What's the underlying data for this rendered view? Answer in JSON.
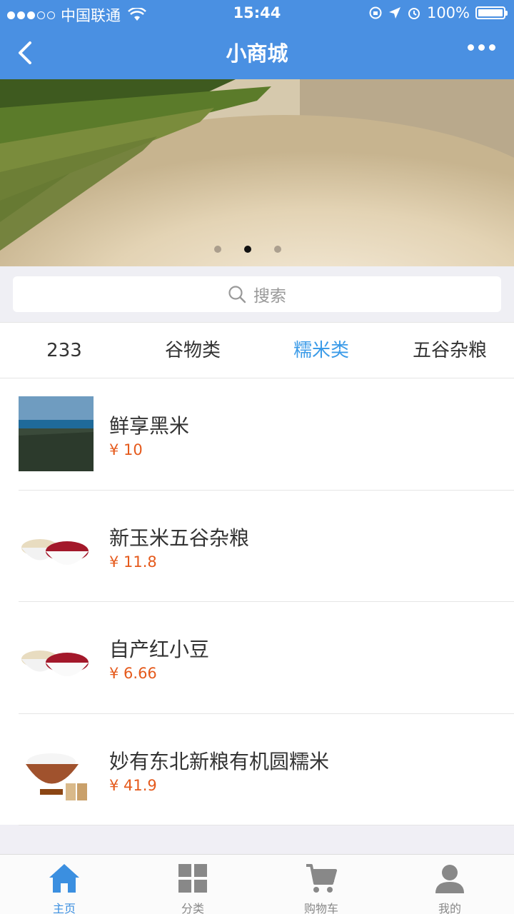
{
  "status_bar": {
    "carrier": "中国联通",
    "time": "15:44",
    "battery": "100%"
  },
  "nav": {
    "title": "小商城"
  },
  "search": {
    "placeholder": "搜索"
  },
  "tabs": [
    {
      "label": "233",
      "active": false
    },
    {
      "label": "谷物类",
      "active": false
    },
    {
      "label": "糯米类",
      "active": true
    },
    {
      "label": "五谷杂粮",
      "active": false
    }
  ],
  "products": [
    {
      "name": "鲜享黑米",
      "price": "¥ 10"
    },
    {
      "name": "新玉米五谷杂粮",
      "price": "¥ 11.8"
    },
    {
      "name": "自产红小豆",
      "price": "¥ 6.66"
    },
    {
      "name": "妙有东北新粮有机圆糯米",
      "price": "¥ 41.9"
    }
  ],
  "tabbar": [
    {
      "label": "主页",
      "icon": "home-icon"
    },
    {
      "label": "分类",
      "icon": "grid-icon"
    },
    {
      "label": "购物车",
      "icon": "cart-icon"
    },
    {
      "label": "我的",
      "icon": "user-icon"
    }
  ],
  "colors": {
    "brand": "#4a90e2",
    "active_tab": "#3b9be8",
    "price": "#e55a1c"
  }
}
